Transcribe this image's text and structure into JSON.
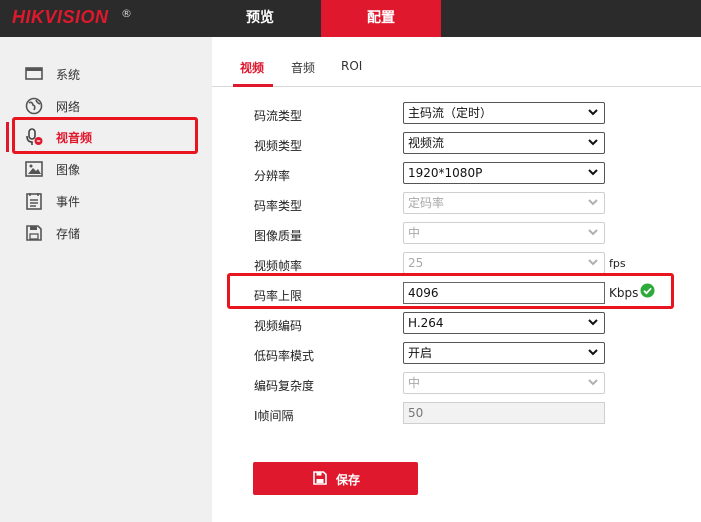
{
  "header": {
    "logo_text": "HIKVISION",
    "logo_mark": "®",
    "nav": [
      {
        "label": "预览",
        "active": false
      },
      {
        "label": "配置",
        "active": true
      }
    ]
  },
  "sidebar": {
    "items": [
      {
        "label": "系统",
        "icon": "monitor-icon",
        "active": false
      },
      {
        "label": "网络",
        "icon": "globe-icon",
        "active": false
      },
      {
        "label": "视音频",
        "icon": "microphone-icon",
        "active": true
      },
      {
        "label": "图像",
        "icon": "image-icon",
        "active": false
      },
      {
        "label": "事件",
        "icon": "event-list-icon",
        "active": false
      },
      {
        "label": "存储",
        "icon": "floppy-disk-icon",
        "active": false
      }
    ]
  },
  "tabs": [
    {
      "label": "视频",
      "active": true
    },
    {
      "label": "音频",
      "active": false
    },
    {
      "label": "ROI",
      "active": false
    }
  ],
  "form": {
    "stream_type": {
      "label": "码流类型",
      "value": "主码流（定时）",
      "enabled": true
    },
    "video_type": {
      "label": "视频类型",
      "value": "视频流",
      "enabled": true
    },
    "resolution": {
      "label": "分辨率",
      "value": "1920*1080P",
      "enabled": true
    },
    "bitrate_type": {
      "label": "码率类型",
      "value": "定码率",
      "enabled": false
    },
    "image_quality": {
      "label": "图像质量",
      "value": "中",
      "enabled": false
    },
    "frame_rate": {
      "label": "视频帧率",
      "value": "25",
      "unit": "fps",
      "enabled": false
    },
    "max_bitrate": {
      "label": "码率上限",
      "value": "4096",
      "unit": "Kbps",
      "status_icon": "check-circle-icon"
    },
    "video_encoding": {
      "label": "视频编码",
      "value": "H.264",
      "enabled": true
    },
    "low_bitrate_mode": {
      "label": "低码率模式",
      "value": "开启",
      "enabled": true
    },
    "encoding_complexity": {
      "label": "编码复杂度",
      "value": "中",
      "enabled": false
    },
    "i_frame_interval": {
      "label": "I帧间隔",
      "value": "50",
      "enabled": false
    }
  },
  "save_button": {
    "label": "保存",
    "icon": "floppy-disk-icon"
  },
  "colors": {
    "brand_red": "#e0182d",
    "header_bg": "#2b2b2b",
    "sidebar_bg": "#f0f0f0",
    "annotation_red": "#e8151f",
    "success_green": "#2eaa3a"
  }
}
